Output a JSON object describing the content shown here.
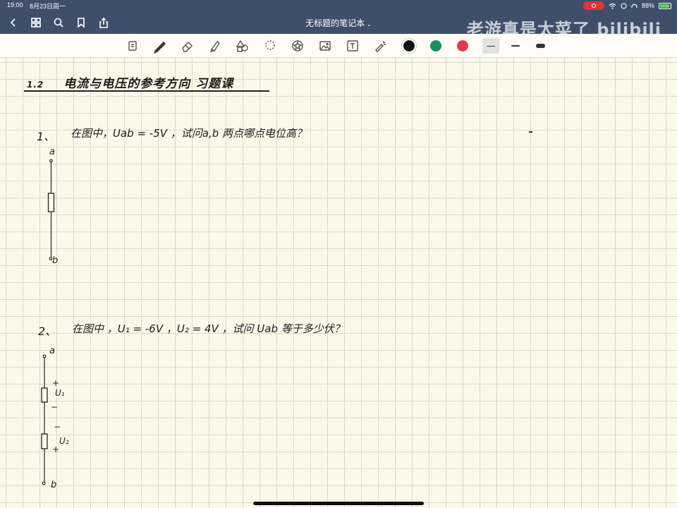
{
  "status": {
    "time": "19:00",
    "date": "8月23日周一",
    "battery": "88%"
  },
  "header": {
    "title": "无标题的笔记本",
    "title_chevron": "⌄",
    "watermark": "老游真是太菜了 bilibili"
  },
  "toolbar": {
    "tools": [
      "page-icon",
      "pen-icon",
      "eraser-icon",
      "highlighter-icon",
      "shapes-icon",
      "lasso-icon",
      "sticker-icon",
      "image-icon",
      "text-icon",
      "laser-icon"
    ],
    "colors": [
      {
        "name": "black",
        "hex": "#111111",
        "selected": true
      },
      {
        "name": "green",
        "hex": "#1a8f5a",
        "selected": false
      },
      {
        "name": "red",
        "hex": "#e03c4b",
        "selected": false
      }
    ],
    "stroke_sizes": [
      "thin",
      "medium",
      "thick"
    ],
    "selected_stroke": "thin"
  },
  "note": {
    "heading_number": "1.2",
    "heading_text": "电流与电压的参考方向    习题课",
    "q1": {
      "number": "1、",
      "text": "在图中，Uab = -5V ，试问a,b 两点哪点电位高？",
      "node_a": "a",
      "node_b": "b"
    },
    "q2": {
      "number": "2、",
      "text": "在图中 ，U₁ = -6V ，U₂ = 4V ，试问 Uab 等于多少伏？",
      "node_a": "a",
      "node_b": "b",
      "r1_plus": "+",
      "r1_label": "U₁",
      "r1_minus": "−",
      "r2_minus": "−",
      "r2_label": "U₂",
      "r2_plus": "+"
    }
  }
}
